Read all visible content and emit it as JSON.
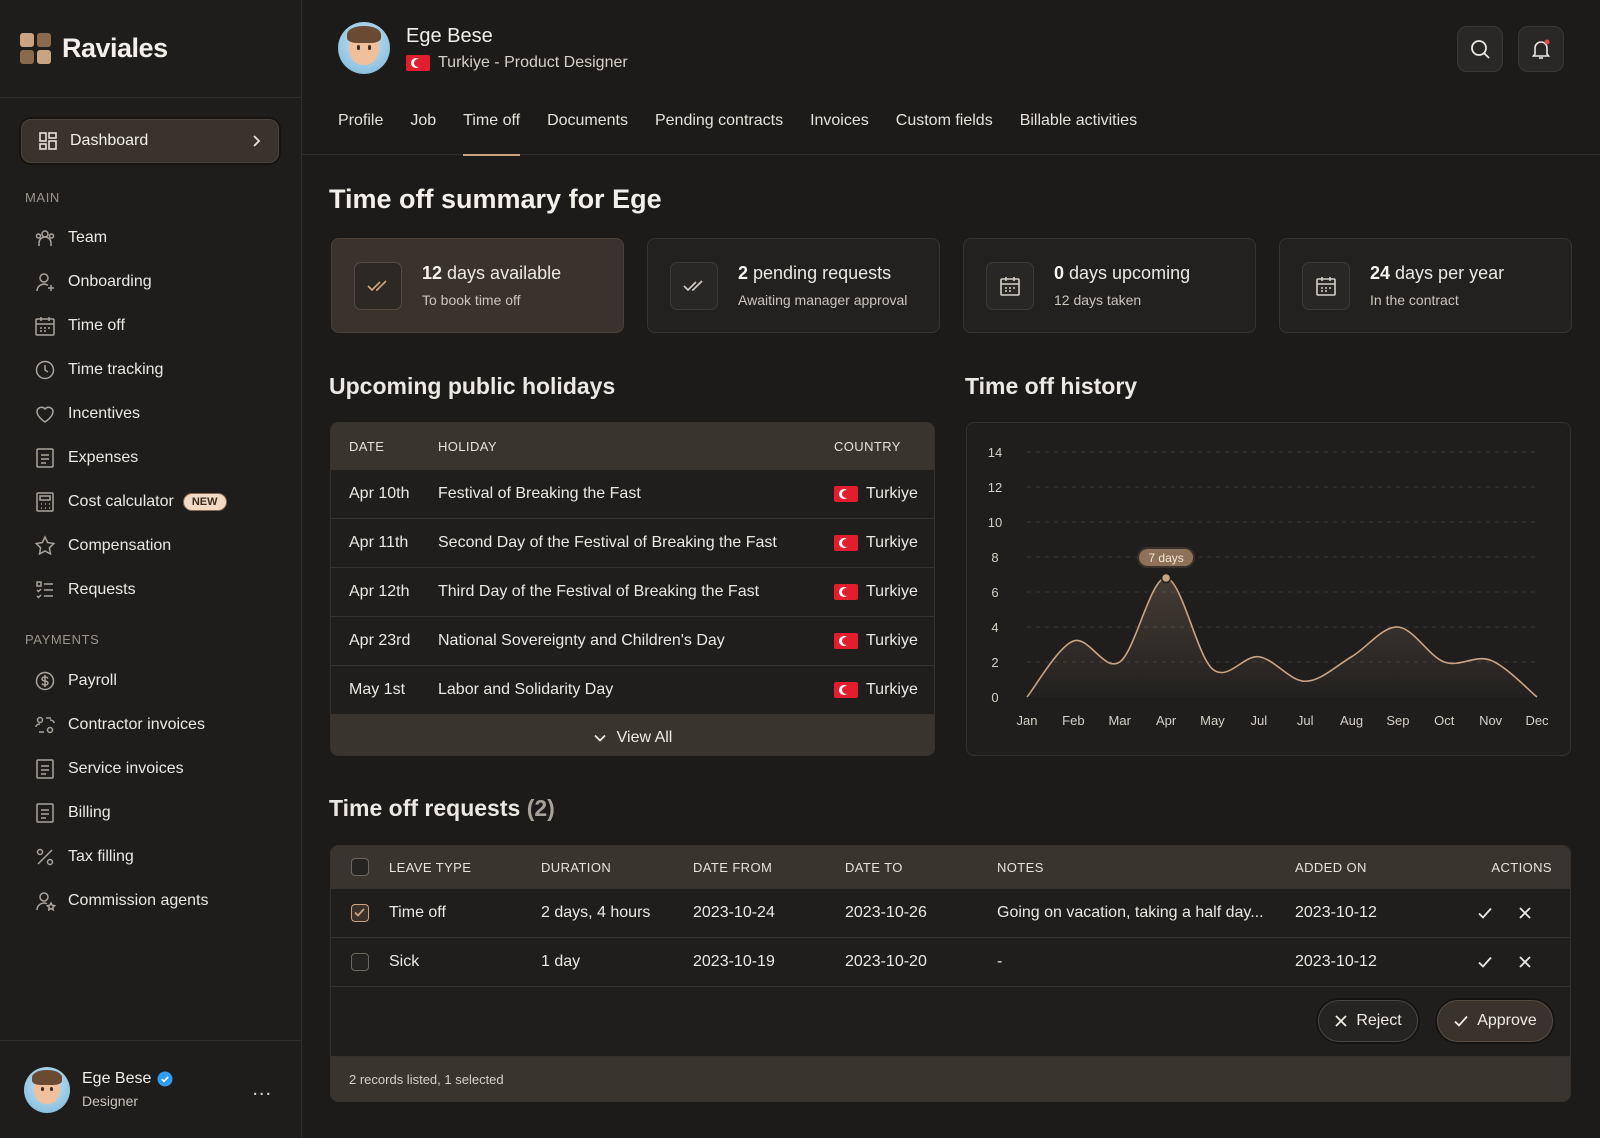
{
  "brand": {
    "name": "Raviales"
  },
  "sidebar": {
    "dashboard_label": "Dashboard",
    "main_label": "MAIN",
    "main_items": [
      {
        "label": "Team",
        "icon": "team-icon"
      },
      {
        "label": "Onboarding",
        "icon": "user-plus-icon"
      },
      {
        "label": "Time off",
        "icon": "calendar-icon"
      },
      {
        "label": "Time tracking",
        "icon": "clock-icon"
      },
      {
        "label": "Incentives",
        "icon": "heart-icon"
      },
      {
        "label": "Expenses",
        "icon": "document-icon"
      },
      {
        "label": "Cost calculator",
        "icon": "calculator-icon",
        "badge": "NEW"
      },
      {
        "label": "Compensation",
        "icon": "star-icon"
      },
      {
        "label": "Requests",
        "icon": "checklist-icon"
      }
    ],
    "payments_label": "PAYMENTS",
    "payment_items": [
      {
        "label": "Payroll",
        "icon": "dollar-circle-icon"
      },
      {
        "label": "Contractor invoices",
        "icon": "contractor-icon"
      },
      {
        "label": "Service invoices",
        "icon": "document-icon"
      },
      {
        "label": "Billing",
        "icon": "document-icon"
      },
      {
        "label": "Tax filling",
        "icon": "percent-icon"
      },
      {
        "label": "Commission agents",
        "icon": "user-star-icon"
      }
    ],
    "user": {
      "name": "Ege Bese",
      "role": "Designer",
      "more": "..."
    }
  },
  "header": {
    "name": "Ege Bese",
    "subtitle": "Turkiye - Product Designer",
    "tabs": [
      "Profile",
      "Job",
      "Time off",
      "Documents",
      "Pending contracts",
      "Invoices",
      "Custom fields",
      "Billable activities"
    ],
    "active_tab": "Time off"
  },
  "page": {
    "title": "Time off summary for Ege",
    "stats": [
      {
        "value": "12",
        "label": " days available",
        "sub": "To book time off",
        "icon": "double-check-icon"
      },
      {
        "value": "2",
        "label": " pending requests",
        "sub": "Awaiting manager approval",
        "icon": "double-check-icon"
      },
      {
        "value": "0",
        "label": " days upcoming",
        "sub": "12 days taken",
        "icon": "calendar-icon"
      },
      {
        "value": "24",
        "label": " days per year",
        "sub": "In the contract",
        "icon": "calendar-icon"
      }
    ]
  },
  "holidays": {
    "title": "Upcoming public holidays",
    "headers": [
      "DATE",
      "HOLIDAY",
      "COUNTRY"
    ],
    "rows": [
      {
        "date": "Apr 10th",
        "holiday": "Festival of Breaking the Fast",
        "country": "Turkiye"
      },
      {
        "date": "Apr 11th",
        "holiday": "Second Day of the Festival of Breaking the Fast",
        "country": "Turkiye"
      },
      {
        "date": "Apr 12th",
        "holiday": "Third Day of the Festival of Breaking the Fast",
        "country": "Turkiye"
      },
      {
        "date": "Apr 23rd",
        "holiday": "National Sovereignty and Children's Day",
        "country": "Turkiye"
      },
      {
        "date": "May 1st",
        "holiday": "Labor and Solidarity Day",
        "country": "Turkiye"
      }
    ],
    "view_all": "View All"
  },
  "history": {
    "title": "Time off history",
    "tooltip": "7 days"
  },
  "chart_data": {
    "type": "area",
    "title": "",
    "categories": [
      "Jan",
      "Feb",
      "Mar",
      "Apr",
      "May",
      "Jul",
      "Jul",
      "Aug",
      "Sep",
      "Oct",
      "Nov",
      "Dec"
    ],
    "values": [
      0,
      3.2,
      2.0,
      6.8,
      1.6,
      2.3,
      0.9,
      2.3,
      4.0,
      2.0,
      2.1,
      0
    ],
    "ylim": [
      0,
      14
    ],
    "yticks": [
      0,
      2,
      4,
      6,
      8,
      10,
      12,
      14
    ],
    "grid": true,
    "highlight": {
      "category": "Apr",
      "label": "7 days"
    },
    "color": "#c9a483"
  },
  "requests": {
    "title": "Time off requests",
    "count": "(2)",
    "headers": [
      "LEAVE TYPE",
      "DURATION",
      "DATE FROM",
      "DATE TO",
      "NOTES",
      "ADDED ON",
      "ACTIONS"
    ],
    "rows": [
      {
        "type": "Time off",
        "duration": "2 days, 4 hours",
        "from": "2023-10-24",
        "to": "2023-10-26",
        "notes": "Going on vacation, taking a half day...",
        "added": "2023-10-12",
        "checked": true
      },
      {
        "type": "Sick",
        "duration": "1 day",
        "from": "2023-10-19",
        "to": "2023-10-20",
        "notes": "-",
        "added": "2023-10-12",
        "checked": false
      }
    ],
    "reject_label": "Reject",
    "approve_label": "Approve",
    "status": "2 records listed, 1 selected"
  },
  "colors": {
    "accent": "#c9a483",
    "bg": "#1c1b1a",
    "flag_red": "#e11d2e"
  }
}
